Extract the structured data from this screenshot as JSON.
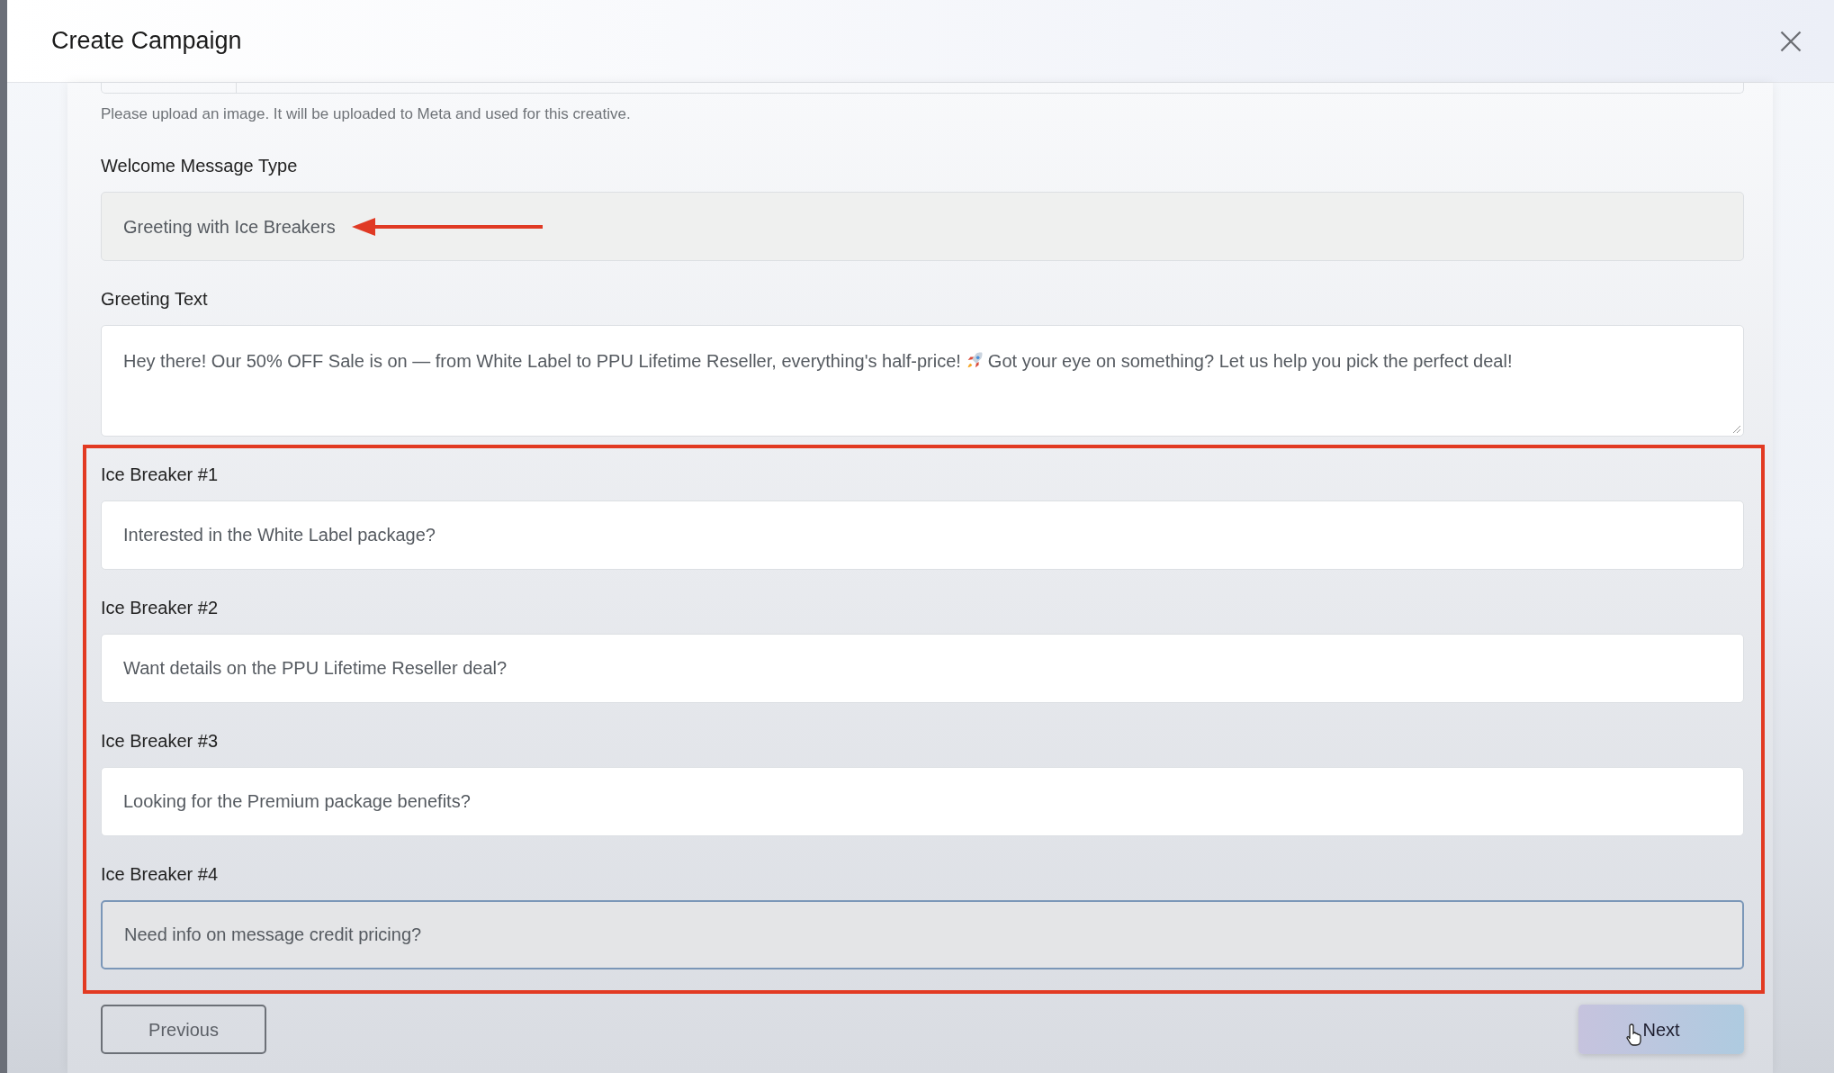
{
  "dialog": {
    "title": "Create Campaign"
  },
  "image_upload": {
    "helper_text": "Please upload an image. It will be uploaded to Meta and used for this creative."
  },
  "welcome_message_type": {
    "label": "Welcome Message Type",
    "value": "Greeting with Ice Breakers",
    "disabled": true
  },
  "greeting_text": {
    "label": "Greeting Text",
    "text_before_icon": "Hey there! Our 50% OFF Sale is on — from White Label to PPU Lifetime Reseller, everything's half-price!",
    "text_after_icon": "Got your eye on something? Let us help you pick the perfect deal!"
  },
  "ice_breakers": [
    {
      "label": "Ice Breaker #1",
      "value": "Interested in the White Label package?",
      "focused": false
    },
    {
      "label": "Ice Breaker #2",
      "value": "Want details on the PPU Lifetime Reseller deal?",
      "focused": false
    },
    {
      "label": "Ice Breaker #3",
      "value": "Looking for the Premium package benefits?",
      "focused": false
    },
    {
      "label": "Ice Breaker #4",
      "value": "Need info on message credit pricing?",
      "focused": true
    }
  ],
  "buttons": {
    "previous": "Previous",
    "next": "Next"
  }
}
